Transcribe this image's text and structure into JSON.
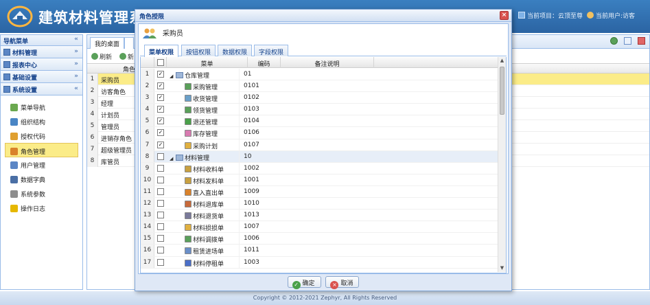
{
  "header": {
    "app_title": "建筑材料管理系",
    "project_label": "当前项目：云顶至尊",
    "user_label": "当前用户:访客"
  },
  "sidebar": {
    "title": "导航菜单",
    "collapse_icon": "«",
    "groups": [
      {
        "label": "材料管理",
        "chevron": "»"
      },
      {
        "label": "报表中心",
        "chevron": "»"
      },
      {
        "label": "基础设置",
        "chevron": "»"
      },
      {
        "label": "系统设置",
        "chevron": "«"
      }
    ],
    "items": [
      {
        "label": "菜单导航",
        "icon": "menu-tree-icon",
        "color": "#6aa84f"
      },
      {
        "label": "组织结构",
        "icon": "org-chart-icon",
        "color": "#4a86c5"
      },
      {
        "label": "授权代码",
        "icon": "key-icon",
        "color": "#e0a030"
      },
      {
        "label": "角色管理",
        "icon": "role-icon",
        "color": "#d9822b"
      },
      {
        "label": "用户管理",
        "icon": "user-icon",
        "color": "#5b86c5"
      },
      {
        "label": "数据字典",
        "icon": "dictionary-icon",
        "color": "#4a6fa5"
      },
      {
        "label": "系统参数",
        "icon": "settings-icon",
        "color": "#8e8e8e"
      },
      {
        "label": "操作日志",
        "icon": "warning-icon",
        "color": "#e6b800"
      }
    ]
  },
  "main": {
    "tabs": [
      {
        "label": "我的桌面"
      }
    ],
    "toolbar": {
      "refresh": "刷新",
      "add": "新"
    },
    "bg_column": "角色",
    "roles": [
      "采购员",
      "访客角色",
      "经理",
      "计划员",
      "管理员",
      "进销存角色",
      "超级管理员",
      "库管员"
    ]
  },
  "dialog": {
    "title": "角色授限",
    "close_icon": "×",
    "role_name": "采购员",
    "tabs": [
      "菜单权限",
      "按钮权限",
      "数据权限",
      "字段权限"
    ],
    "columns": {
      "menu": "菜单",
      "code": "编码",
      "remark": "备注说明"
    },
    "rows": [
      {
        "num": "1",
        "checked": true,
        "level": 0,
        "toggle": "◢",
        "name": "仓库管理",
        "code": "01",
        "icon_color": "#6a8fc8"
      },
      {
        "num": "2",
        "checked": true,
        "level": 1,
        "toggle": "",
        "name": "采购管理",
        "code": "0101",
        "icon_color": "#5aa05a"
      },
      {
        "num": "3",
        "checked": true,
        "level": 1,
        "toggle": "",
        "name": "收货管理",
        "code": "0102",
        "icon_color": "#6a9fc8"
      },
      {
        "num": "4",
        "checked": true,
        "level": 1,
        "toggle": "",
        "name": "领货管理",
        "code": "0103",
        "icon_color": "#5aa05a"
      },
      {
        "num": "5",
        "checked": true,
        "level": 1,
        "toggle": "",
        "name": "退还管理",
        "code": "0104",
        "icon_color": "#4aa04a"
      },
      {
        "num": "6",
        "checked": true,
        "level": 1,
        "toggle": "",
        "name": "库存管理",
        "code": "0106",
        "icon_color": "#d87ab0"
      },
      {
        "num": "7",
        "checked": true,
        "level": 1,
        "toggle": "",
        "name": "采购计划",
        "code": "0107",
        "icon_color": "#e0b040"
      },
      {
        "num": "8",
        "checked": false,
        "level": 0,
        "toggle": "◢",
        "name": "材料管理",
        "code": "10",
        "icon_color": "#6a8fc8"
      },
      {
        "num": "9",
        "checked": false,
        "level": 1,
        "toggle": "",
        "name": "材料收料单",
        "code": "1002",
        "icon_color": "#c8a040"
      },
      {
        "num": "10",
        "checked": false,
        "level": 1,
        "toggle": "",
        "name": "材料发料单",
        "code": "1001",
        "icon_color": "#c8a040"
      },
      {
        "num": "11",
        "checked": false,
        "level": 1,
        "toggle": "",
        "name": "直入直出单",
        "code": "1009",
        "icon_color": "#d9822b"
      },
      {
        "num": "12",
        "checked": false,
        "level": 1,
        "toggle": "",
        "name": "材料退库单",
        "code": "1010",
        "icon_color": "#c86a3a"
      },
      {
        "num": "13",
        "checked": false,
        "level": 1,
        "toggle": "",
        "name": "材料退货单",
        "code": "1013",
        "icon_color": "#7a7a9a"
      },
      {
        "num": "14",
        "checked": false,
        "level": 1,
        "toggle": "",
        "name": "材料损损单",
        "code": "1007",
        "icon_color": "#e0b040"
      },
      {
        "num": "15",
        "checked": false,
        "level": 1,
        "toggle": "",
        "name": "材料调拨单",
        "code": "1006",
        "icon_color": "#5aa05a"
      },
      {
        "num": "16",
        "checked": false,
        "level": 1,
        "toggle": "",
        "name": "租赁进场单",
        "code": "1011",
        "icon_color": "#6a8fc8"
      },
      {
        "num": "17",
        "checked": false,
        "level": 1,
        "toggle": "",
        "name": "材料停租单",
        "code": "1003",
        "icon_color": "#4a6fc8"
      }
    ],
    "buttons": {
      "ok": "确定",
      "cancel": "取消"
    }
  },
  "footer": {
    "text": "Copyright © 2012-2021 Zephyr, All Rights Reserved"
  }
}
